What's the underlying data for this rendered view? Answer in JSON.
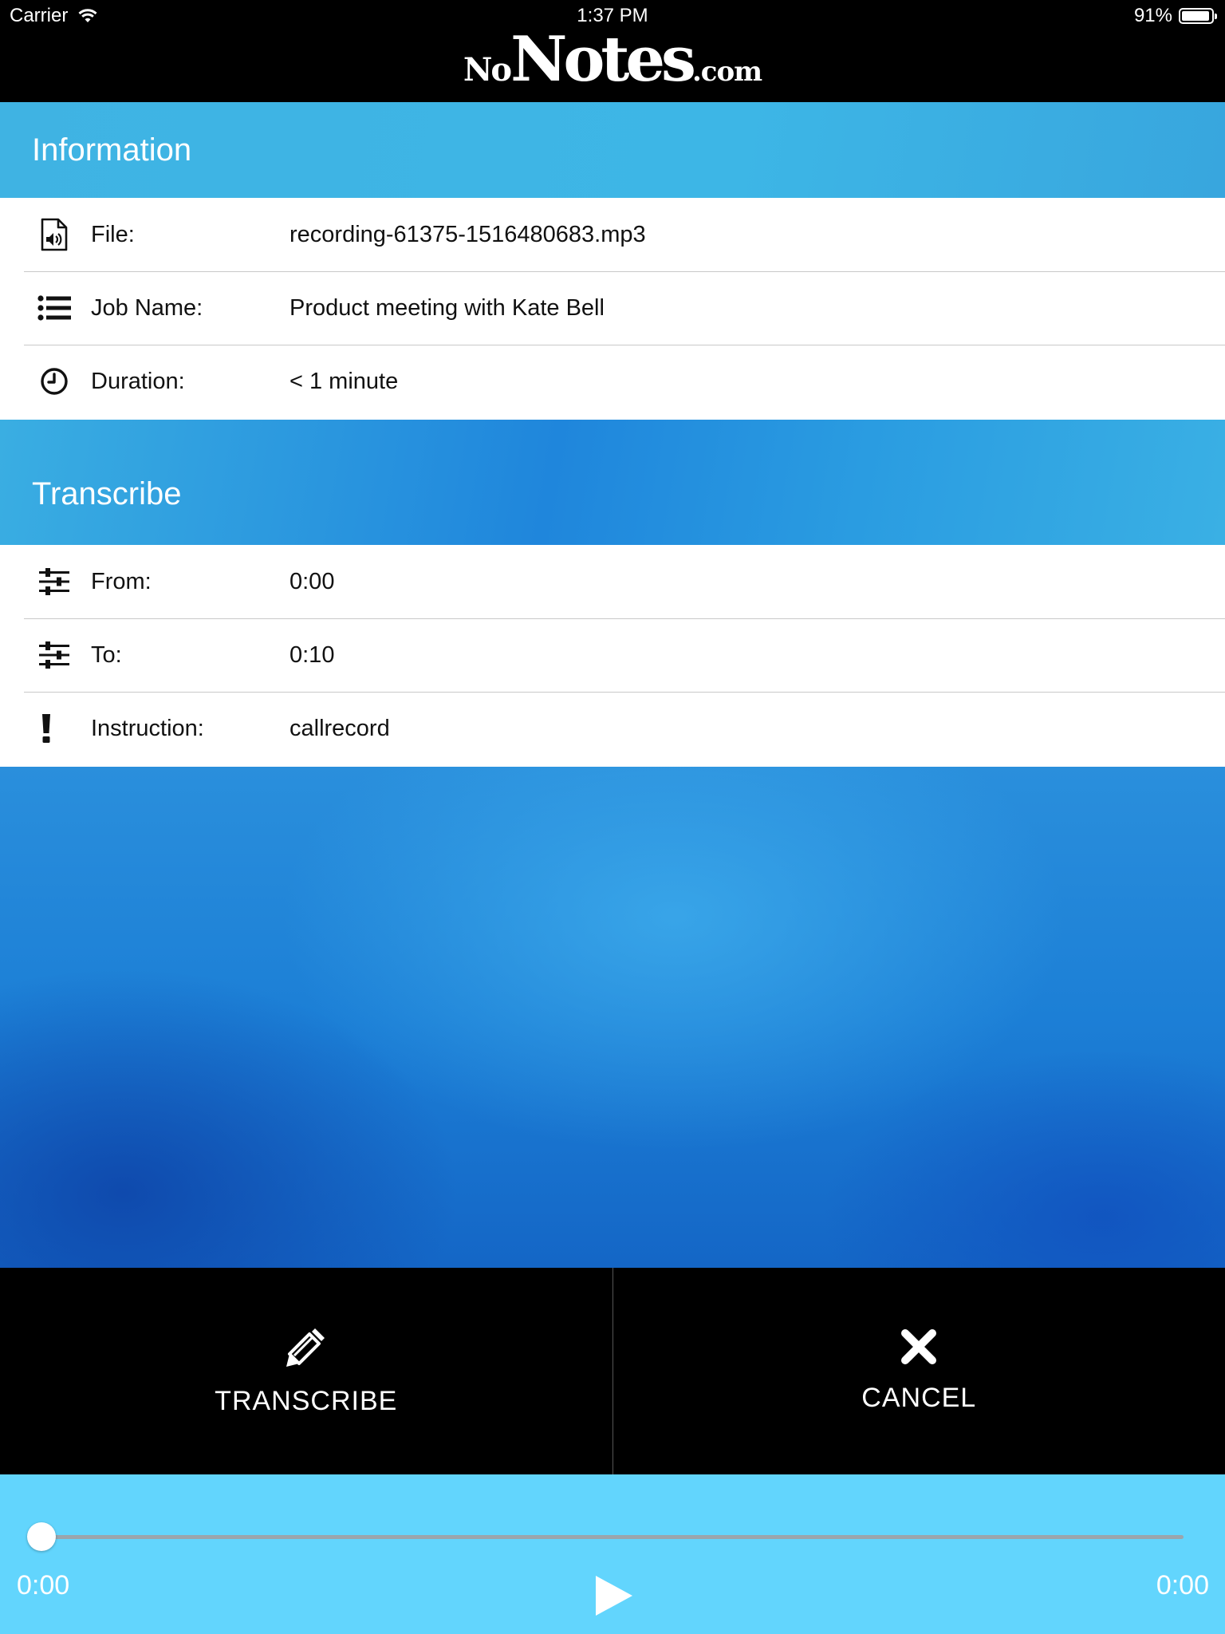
{
  "status_bar": {
    "carrier": "Carrier",
    "time": "1:37 PM",
    "battery": "91%"
  },
  "header": {
    "logo_no": "No",
    "logo_notes": "Notes",
    "logo_com": ".com"
  },
  "information": {
    "title": "Information",
    "rows": [
      {
        "icon": "audio-file-icon",
        "label": "File:",
        "value": "recording-61375-1516480683.mp3"
      },
      {
        "icon": "list-icon",
        "label": "Job Name:",
        "value": "Product meeting with Kate Bell"
      },
      {
        "icon": "clock-icon",
        "label": "Duration:",
        "value": "< 1 minute"
      }
    ]
  },
  "transcribe": {
    "title": "Transcribe",
    "rows": [
      {
        "icon": "sliders-icon",
        "label": "From:",
        "value": "0:00"
      },
      {
        "icon": "sliders-icon",
        "label": "To:",
        "value": "0:10"
      },
      {
        "icon": "exclamation-icon",
        "label": "Instruction:",
        "value": "callrecord"
      }
    ]
  },
  "actions": {
    "transcribe_label": "TRANSCRIBE",
    "cancel_label": "CANCEL"
  },
  "player": {
    "current_time": "0:00",
    "total_time": "0:00",
    "progress": 0
  }
}
